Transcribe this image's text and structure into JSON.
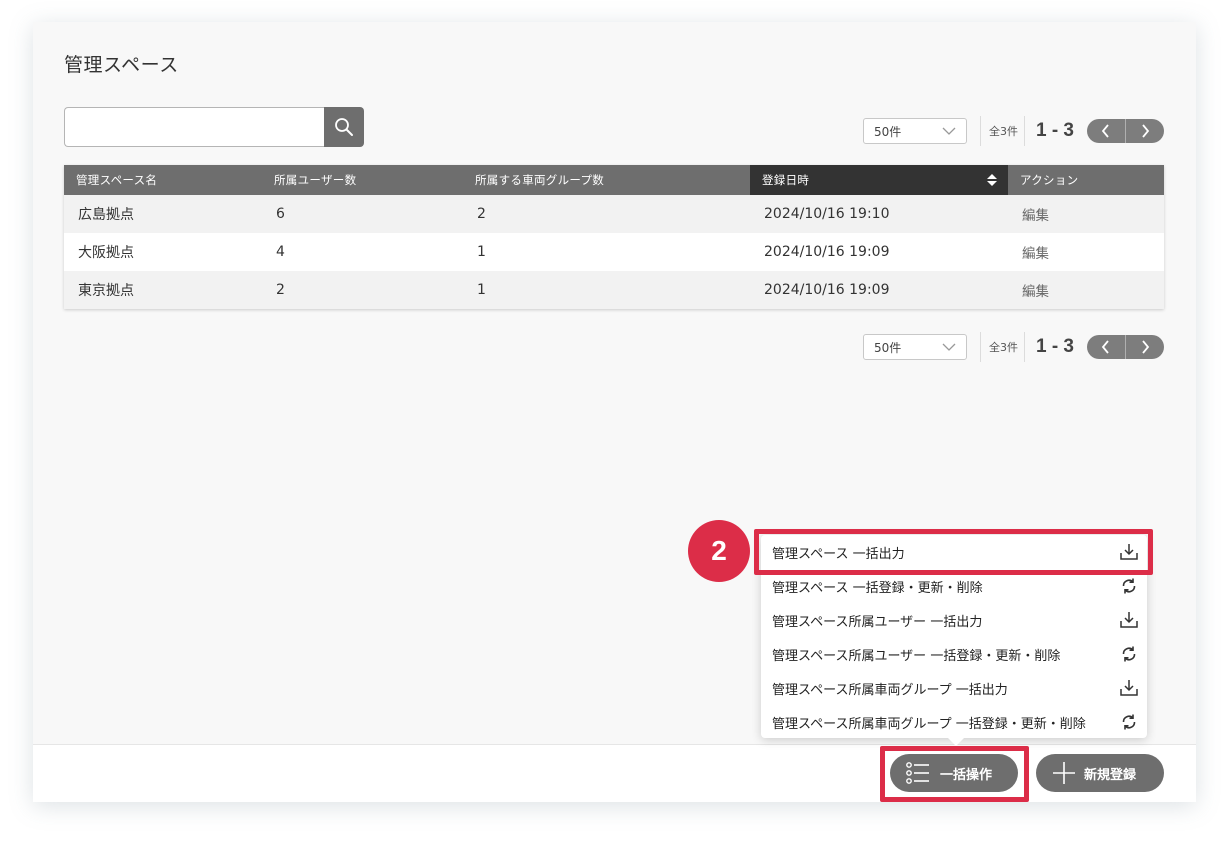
{
  "page": {
    "title": "管理スペース"
  },
  "search": {
    "value": "",
    "placeholder": ""
  },
  "pager": {
    "per_page": "50件",
    "total": "全3件",
    "range": "1 - 3"
  },
  "table": {
    "columns": [
      "管理スペース名",
      "所属ユーザー数",
      "所属する車両グループ数",
      "登録日時",
      "アクション"
    ],
    "sorted_column": "登録日時",
    "rows": [
      {
        "name": "広島拠点",
        "users": "6",
        "groups": "2",
        "date": "2024/10/16 19:10",
        "action": "編集"
      },
      {
        "name": "大阪拠点",
        "users": "4",
        "groups": "1",
        "date": "2024/10/16 19:09",
        "action": "編集"
      },
      {
        "name": "東京拠点",
        "users": "2",
        "groups": "1",
        "date": "2024/10/16 19:09",
        "action": "編集"
      }
    ]
  },
  "bulk_menu": {
    "items": [
      {
        "label": "管理スペース 一括出力",
        "icon": "download-icon"
      },
      {
        "label": "管理スペース 一括登録・更新・削除",
        "icon": "sync-icon"
      },
      {
        "label": "管理スペース所属ユーザー 一括出力",
        "icon": "download-icon"
      },
      {
        "label": "管理スペース所属ユーザー 一括登録・更新・削除",
        "icon": "sync-icon"
      },
      {
        "label": "管理スペース所属車両グループ 一括出力",
        "icon": "download-icon"
      },
      {
        "label": "管理スペース所属車両グループ 一括登録・更新・削除",
        "icon": "sync-icon"
      }
    ]
  },
  "footer": {
    "bulk_label": "一括操作",
    "new_label": "新規登録"
  },
  "annotation": {
    "step": "2",
    "color": "#dc2d48"
  }
}
